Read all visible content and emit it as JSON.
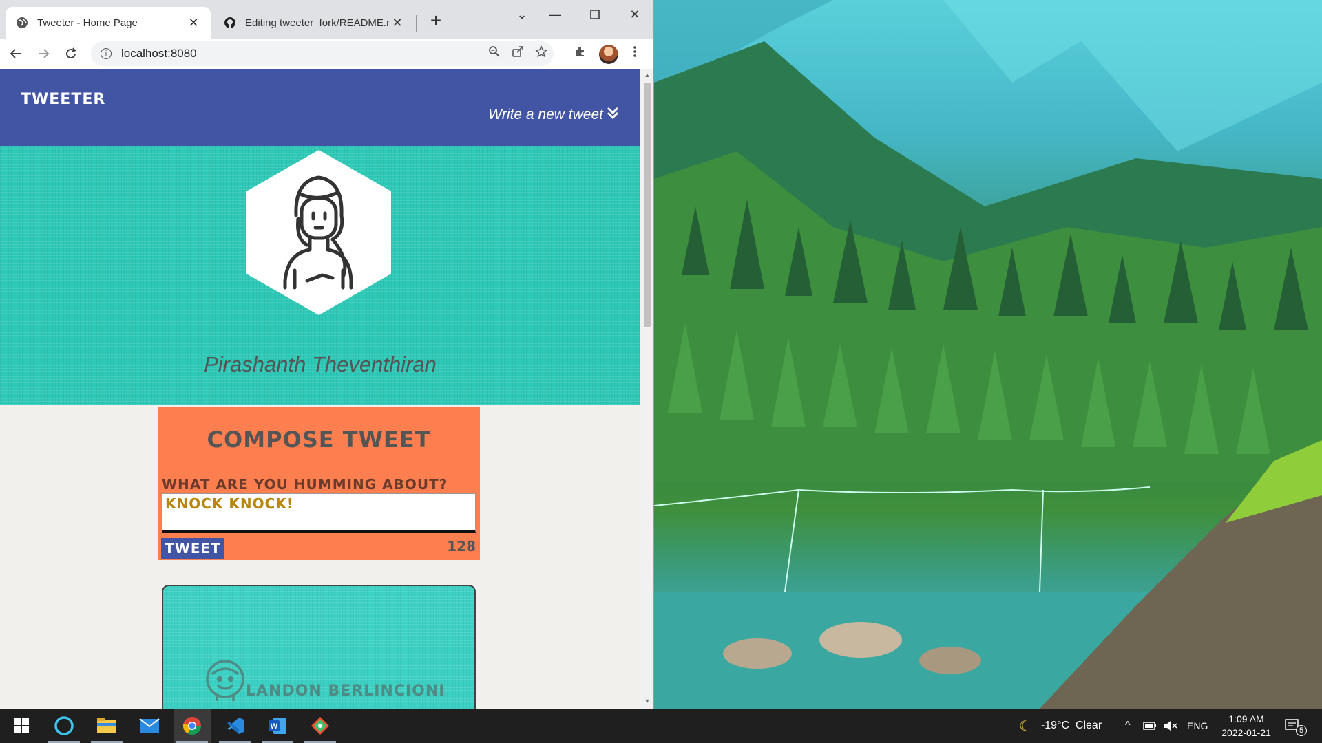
{
  "browser": {
    "tabs": [
      {
        "title": "Tweeter - Home Page",
        "active": true
      },
      {
        "title": "Editing tweeter_fork/README.m",
        "active": false
      }
    ],
    "new_tab": "+",
    "address": "localhost:8080"
  },
  "page": {
    "brand": "TWEETER",
    "write_link": "Write a new tweet",
    "profile_name": "Pirashanth Theventhiran",
    "compose": {
      "heading": "COMPOSE TWEET",
      "label": "WHAT ARE YOU HUMMING ABOUT?",
      "value": "KNOCK KNOCK!",
      "button": "TWEET",
      "counter": "128"
    },
    "tweet": {
      "author": "LANDON BERLINCIONI"
    }
  },
  "taskbar": {
    "weather": "-19°C  Clear",
    "language": "ENG",
    "time": "1:09 AM",
    "date": "2022-01-21",
    "notifications": "5"
  },
  "colors": {
    "navbar": "#4254a4",
    "profile_bg": "#2fc9b8",
    "compose_bg": "#fd7f4f",
    "page_bg": "#f2f0ed"
  }
}
